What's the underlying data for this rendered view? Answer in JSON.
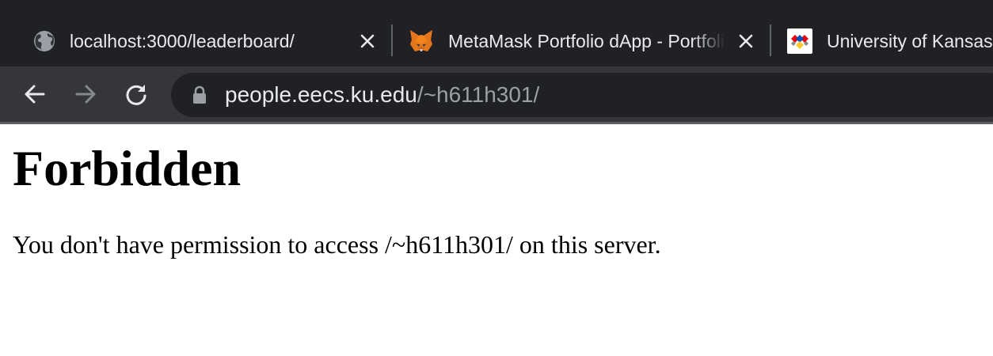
{
  "tabs": [
    {
      "title": "localhost:3000/leaderboard/",
      "favicon": "globe-icon"
    },
    {
      "title": "MetaMask Portfolio dApp - Portfolio",
      "favicon": "metamask-fox-icon"
    },
    {
      "title": "University of Kansas",
      "favicon": "ku-logo-icon"
    }
  ],
  "toolbar": {
    "back_icon": "back-arrow-icon",
    "forward_icon": "forward-arrow-icon",
    "reload_icon": "reload-icon",
    "url_host": "people.eecs.ku.edu",
    "url_path": "/~h611h301/",
    "lock_icon": "lock-icon"
  },
  "page": {
    "heading": "Forbidden",
    "message": "You don't have permission to access /~h611h301/ on this server."
  },
  "colors": {
    "tabstrip_bg": "#202124",
    "toolbar_bg": "#35363a",
    "omnibox_bg": "#202124",
    "text_light": "#e8eaed",
    "text_muted": "#9aa0a6",
    "metamask_orange": "#e2761b"
  }
}
